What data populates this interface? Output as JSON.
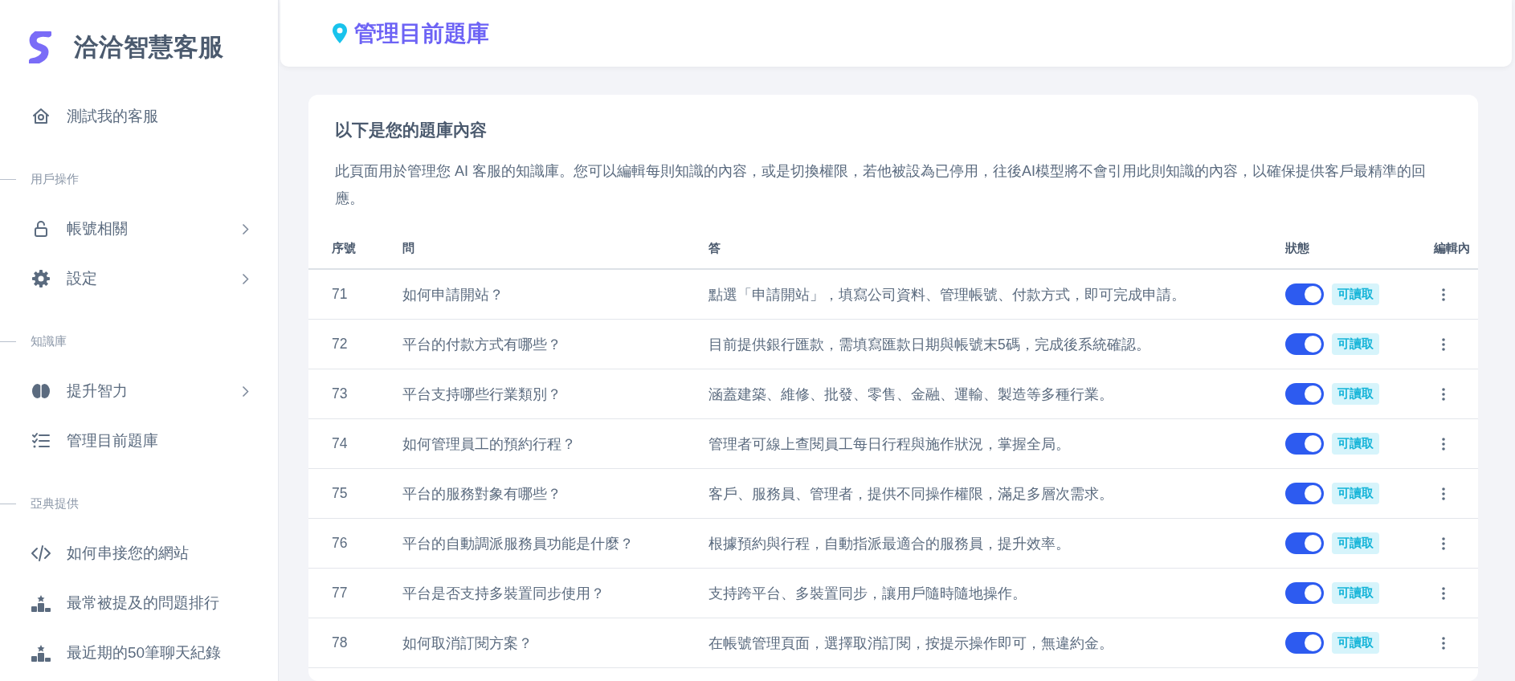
{
  "sidebar": {
    "brand": "洽洽智慧客服",
    "items": [
      {
        "kind": "link",
        "label": "測試我的客服",
        "expandable": false
      },
      {
        "kind": "section",
        "label": "用戶操作"
      },
      {
        "kind": "link",
        "label": "帳號相關",
        "expandable": true
      },
      {
        "kind": "link",
        "label": "設定",
        "expandable": true
      },
      {
        "kind": "section",
        "label": "知識庫"
      },
      {
        "kind": "link",
        "label": "提升智力",
        "expandable": true
      },
      {
        "kind": "link",
        "label": "管理目前題庫",
        "expandable": false
      },
      {
        "kind": "section",
        "label": "亞典提供"
      },
      {
        "kind": "link",
        "label": "如何串接您的網站",
        "expandable": false
      },
      {
        "kind": "link",
        "label": "最常被提及的問題排行",
        "expandable": false
      },
      {
        "kind": "link",
        "label": "最近期的50筆聊天紀錄",
        "expandable": false
      }
    ]
  },
  "page_header": {
    "title": "管理目前題庫"
  },
  "card": {
    "title": "以下是您的題庫內容",
    "description": "此頁面用於管理您 AI 客服的知識庫。您可以編輯每則知識的內容，或是切換權限，若他被設為已停用，往後AI模型將不會引用此則知識的內容，以確保提供客戶最精準的回應。",
    "table": {
      "columns": [
        "序號",
        "問",
        "答",
        "狀態",
        "編輯內"
      ],
      "rows": [
        {
          "number": "71",
          "question": "如何申請開站？",
          "answer": "點選「申請開站」，填寫公司資料、管理帳號、付款方式，即可完成申請。",
          "on": true,
          "status": "可讀取"
        },
        {
          "number": "72",
          "question": "平台的付款方式有哪些？",
          "answer": "目前提供銀行匯款，需填寫匯款日期與帳號末5碼，完成後系統確認。",
          "on": true,
          "status": "可讀取"
        },
        {
          "number": "73",
          "question": "平台支持哪些行業類別？",
          "answer": "涵蓋建築、維修、批發、零售、金融、運輸、製造等多種行業。",
          "on": true,
          "status": "可讀取"
        },
        {
          "number": "74",
          "question": "如何管理員工的預約行程？",
          "answer": "管理者可線上查閱員工每日行程與施作狀況，掌握全局。",
          "on": true,
          "status": "可讀取"
        },
        {
          "number": "75",
          "question": "平台的服務對象有哪些？",
          "answer": "客戶、服務員、管理者，提供不同操作權限，滿足多層次需求。",
          "on": true,
          "status": "可讀取"
        },
        {
          "number": "76",
          "question": "平台的自動調派服務員功能是什麼？",
          "answer": "根據預約與行程，自動指派最適合的服務員，提升效率。",
          "on": true,
          "status": "可讀取"
        },
        {
          "number": "77",
          "question": "平台是否支持多裝置同步使用？",
          "answer": "支持跨平台、多裝置同步，讓用戶隨時隨地操作。",
          "on": true,
          "status": "可讀取"
        },
        {
          "number": "78",
          "question": "如何取消訂閱方案？",
          "answer": "在帳號管理頁面，選擇取消訂閱，按提示操作即可，無違約金。",
          "on": true,
          "status": "可讀取"
        }
      ]
    }
  }
}
